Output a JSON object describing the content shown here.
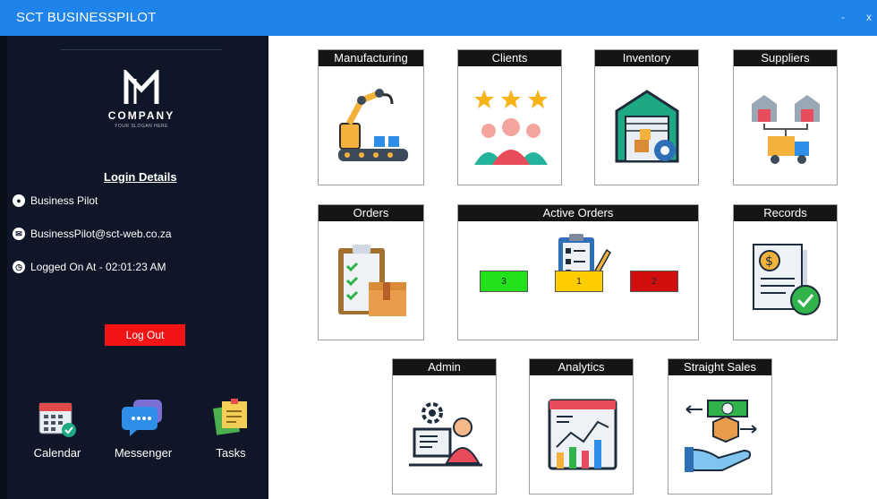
{
  "window": {
    "title": "SCT BUSINESSPILOT",
    "minimize": "-",
    "close": "x"
  },
  "sidebar": {
    "company": "COMPANY",
    "slogan": "YOUR SLOGAN HERE",
    "login_title": "Login Details",
    "user_name": "Business Pilot",
    "email": "BusinessPilot@sct-web.co.za",
    "logged_on": "Logged On At - 02:01:23 AM",
    "logout_label": "Log Out",
    "apps": [
      {
        "label": "Calendar",
        "icon": "calendar-icon"
      },
      {
        "label": "Messenger",
        "icon": "messenger-icon"
      },
      {
        "label": "Tasks",
        "icon": "tasks-icon"
      }
    ]
  },
  "tiles": {
    "manufacturing": "Manufacturing",
    "clients": "Clients",
    "inventory": "Inventory",
    "suppliers": "Suppliers",
    "orders": "Orders",
    "active_orders": "Active Orders",
    "records": "Records",
    "admin": "Admin",
    "analytics": "Analytics",
    "straight_sales": "Straight Sales"
  },
  "active_orders_counts": {
    "green": "3",
    "yellow": "1",
    "red": "2"
  },
  "colors": {
    "titlebar": "#1e83ea",
    "sidebar": "#0f1627",
    "logout": "#f21416",
    "status_green": "#22e11a",
    "status_yellow": "#ffcc00",
    "status_red": "#d10f0f"
  }
}
